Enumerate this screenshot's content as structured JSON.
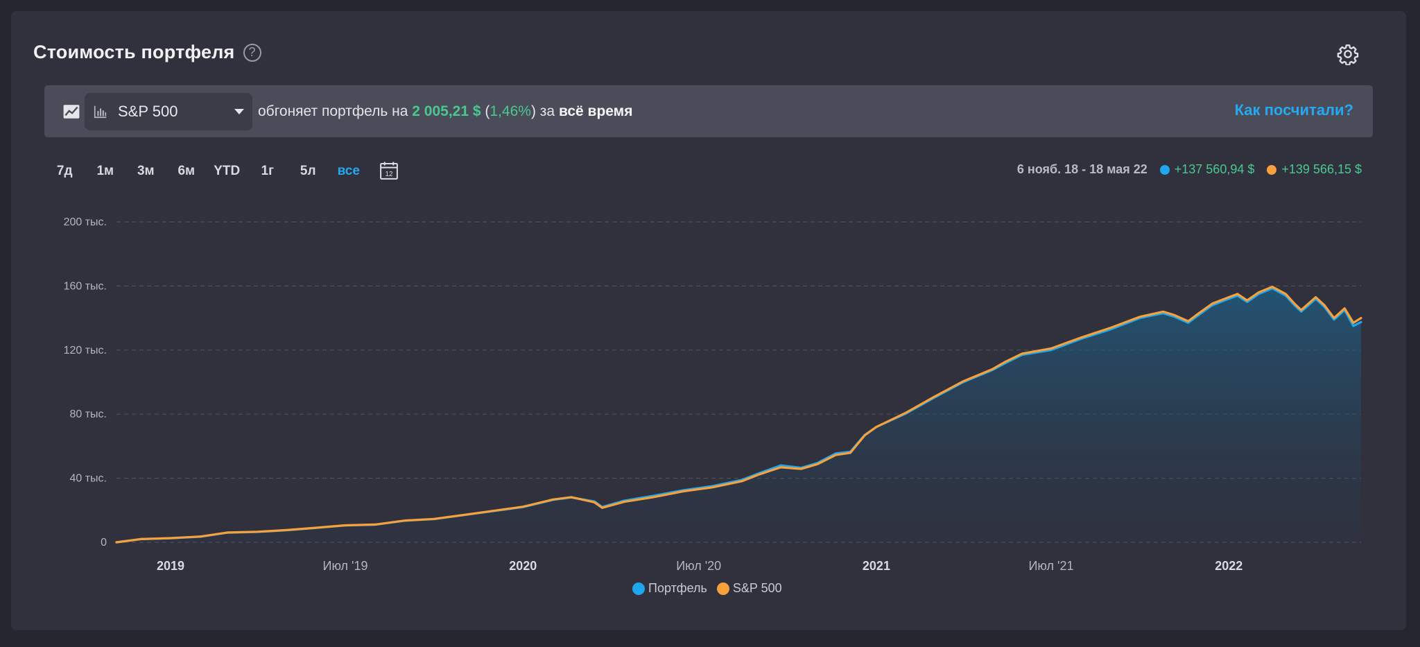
{
  "header": {
    "title": "Стоимость портфеля",
    "help_glyph": "?"
  },
  "banner": {
    "benchmark": "S&P 500",
    "text_before": "обгоняет портфель на",
    "amount": "2 005,21 $",
    "paren_open": "(",
    "percent": "1,46%",
    "paren_close": ")",
    "text_for": "за",
    "period_bold": "всё время",
    "link": "Как посчитали?"
  },
  "periods": [
    "7д",
    "1м",
    "3м",
    "6м",
    "YTD",
    "1г",
    "5л",
    "все"
  ],
  "active_period": "все",
  "calendar_day": "12",
  "summary": {
    "range": "6 нояб. 18 - 18 мая 22",
    "portfolio_change": "+137 560,94 $",
    "sp500_change": "+139 566,15 $"
  },
  "colors": {
    "portfolio": "#1ea6ee",
    "sp500": "#f7a13d",
    "positive": "#49c990",
    "accent": "#26a9f0"
  },
  "chart_data": {
    "type": "area",
    "x_start": "2018-11-06",
    "x_end": "2022-05-18",
    "x_ticks": [
      {
        "label": "2019",
        "date": "2019-01-01",
        "bold": true
      },
      {
        "label": "Июл '19",
        "date": "2019-07-01",
        "bold": false
      },
      {
        "label": "2020",
        "date": "2020-01-01",
        "bold": true
      },
      {
        "label": "Июл '20",
        "date": "2020-07-01",
        "bold": false
      },
      {
        "label": "2021",
        "date": "2021-01-01",
        "bold": true
      },
      {
        "label": "Июл '21",
        "date": "2021-07-01",
        "bold": false
      },
      {
        "label": "2022",
        "date": "2022-01-01",
        "bold": true
      }
    ],
    "y_ticks": [
      {
        "label": "0",
        "value": 0
      },
      {
        "label": "40 тыс.",
        "value": 40000
      },
      {
        "label": "80 тыс.",
        "value": 80000
      },
      {
        "label": "120 тыс.",
        "value": 120000
      },
      {
        "label": "160 тыс.",
        "value": 160000
      },
      {
        "label": "200 тыс.",
        "value": 200000
      }
    ],
    "ylim": [
      0,
      200000
    ],
    "grid": true,
    "legend_position": "bottom",
    "series": [
      {
        "name": "Портфель",
        "color": "#1ea6ee",
        "points": [
          [
            "2018-11-06",
            0
          ],
          [
            "2018-12-01",
            2000
          ],
          [
            "2019-01-01",
            2500
          ],
          [
            "2019-02-01",
            3500
          ],
          [
            "2019-03-01",
            6000
          ],
          [
            "2019-04-01",
            6500
          ],
          [
            "2019-05-01",
            7500
          ],
          [
            "2019-06-01",
            9000
          ],
          [
            "2019-07-01",
            10500
          ],
          [
            "2019-08-01",
            11000
          ],
          [
            "2019-09-01",
            13500
          ],
          [
            "2019-10-01",
            14500
          ],
          [
            "2019-11-01",
            17000
          ],
          [
            "2019-12-01",
            19500
          ],
          [
            "2020-01-01",
            22000
          ],
          [
            "2020-02-01",
            26500
          ],
          [
            "2020-02-20",
            28000
          ],
          [
            "2020-03-15",
            25500
          ],
          [
            "2020-03-23",
            22000
          ],
          [
            "2020-04-15",
            26000
          ],
          [
            "2020-05-15",
            29000
          ],
          [
            "2020-06-15",
            32500
          ],
          [
            "2020-07-15",
            35000
          ],
          [
            "2020-08-15",
            39000
          ],
          [
            "2020-09-01",
            43000
          ],
          [
            "2020-09-24",
            48000
          ],
          [
            "2020-10-15",
            46500
          ],
          [
            "2020-11-01",
            49500
          ],
          [
            "2020-11-20",
            55500
          ],
          [
            "2020-12-05",
            56500
          ],
          [
            "2020-12-20",
            67000
          ],
          [
            "2021-01-01",
            72000
          ],
          [
            "2021-02-01",
            80500
          ],
          [
            "2021-03-01",
            90000
          ],
          [
            "2021-04-01",
            100000
          ],
          [
            "2021-05-01",
            107500
          ],
          [
            "2021-05-15",
            112000
          ],
          [
            "2021-06-01",
            117000
          ],
          [
            "2021-07-01",
            120000
          ],
          [
            "2021-08-01",
            127000
          ],
          [
            "2021-09-01",
            133000
          ],
          [
            "2021-10-01",
            140000
          ],
          [
            "2021-10-25",
            143000
          ],
          [
            "2021-11-05",
            141000
          ],
          [
            "2021-11-20",
            137000
          ],
          [
            "2021-12-01",
            142000
          ],
          [
            "2021-12-15",
            148000
          ],
          [
            "2022-01-01",
            152000
          ],
          [
            "2022-01-10",
            154000
          ],
          [
            "2022-01-20",
            150000
          ],
          [
            "2022-02-01",
            155000
          ],
          [
            "2022-02-15",
            158500
          ],
          [
            "2022-03-01",
            154000
          ],
          [
            "2022-03-10",
            148000
          ],
          [
            "2022-03-17",
            144000
          ],
          [
            "2022-04-01",
            152000
          ],
          [
            "2022-04-10",
            147000
          ],
          [
            "2022-04-20",
            139000
          ],
          [
            "2022-05-01",
            145000
          ],
          [
            "2022-05-10",
            135000
          ],
          [
            "2022-05-18",
            137500
          ]
        ]
      },
      {
        "name": "S&P 500",
        "color": "#f7a13d",
        "points": [
          [
            "2018-11-06",
            0
          ],
          [
            "2018-12-01",
            2000
          ],
          [
            "2019-01-01",
            2600
          ],
          [
            "2019-02-01",
            3600
          ],
          [
            "2019-03-01",
            6100
          ],
          [
            "2019-04-01",
            6600
          ],
          [
            "2019-05-01",
            7600
          ],
          [
            "2019-06-01",
            9100
          ],
          [
            "2019-07-01",
            10600
          ],
          [
            "2019-08-01",
            11100
          ],
          [
            "2019-09-01",
            13600
          ],
          [
            "2019-10-01",
            14600
          ],
          [
            "2019-11-01",
            17100
          ],
          [
            "2019-12-01",
            19600
          ],
          [
            "2020-01-01",
            22200
          ],
          [
            "2020-02-01",
            26700
          ],
          [
            "2020-02-20",
            28200
          ],
          [
            "2020-03-15",
            25000
          ],
          [
            "2020-03-23",
            21500
          ],
          [
            "2020-04-15",
            25300
          ],
          [
            "2020-05-15",
            28200
          ],
          [
            "2020-06-15",
            31800
          ],
          [
            "2020-07-15",
            34300
          ],
          [
            "2020-08-15",
            38200
          ],
          [
            "2020-09-01",
            42200
          ],
          [
            "2020-09-24",
            46800
          ],
          [
            "2020-10-15",
            45800
          ],
          [
            "2020-11-01",
            48800
          ],
          [
            "2020-11-20",
            54500
          ],
          [
            "2020-12-05",
            55800
          ],
          [
            "2020-12-20",
            66800
          ],
          [
            "2021-01-01",
            72000
          ],
          [
            "2021-02-01",
            81000
          ],
          [
            "2021-03-01",
            90500
          ],
          [
            "2021-04-01",
            100500
          ],
          [
            "2021-05-01",
            108000
          ],
          [
            "2021-05-15",
            112800
          ],
          [
            "2021-06-01",
            117800
          ],
          [
            "2021-07-01",
            121000
          ],
          [
            "2021-08-01",
            127800
          ],
          [
            "2021-09-01",
            134000
          ],
          [
            "2021-10-01",
            140800
          ],
          [
            "2021-10-25",
            144000
          ],
          [
            "2021-11-05",
            142000
          ],
          [
            "2021-11-20",
            138000
          ],
          [
            "2021-12-01",
            143000
          ],
          [
            "2021-12-15",
            149000
          ],
          [
            "2022-01-01",
            153000
          ],
          [
            "2022-01-10",
            155000
          ],
          [
            "2022-01-20",
            151000
          ],
          [
            "2022-02-01",
            156000
          ],
          [
            "2022-02-15",
            159500
          ],
          [
            "2022-03-01",
            155000
          ],
          [
            "2022-03-10",
            149000
          ],
          [
            "2022-03-17",
            145000
          ],
          [
            "2022-04-01",
            153000
          ],
          [
            "2022-04-10",
            148000
          ],
          [
            "2022-04-20",
            140000
          ],
          [
            "2022-05-01",
            146000
          ],
          [
            "2022-05-10",
            137000
          ],
          [
            "2022-05-18",
            140000
          ]
        ]
      }
    ]
  }
}
